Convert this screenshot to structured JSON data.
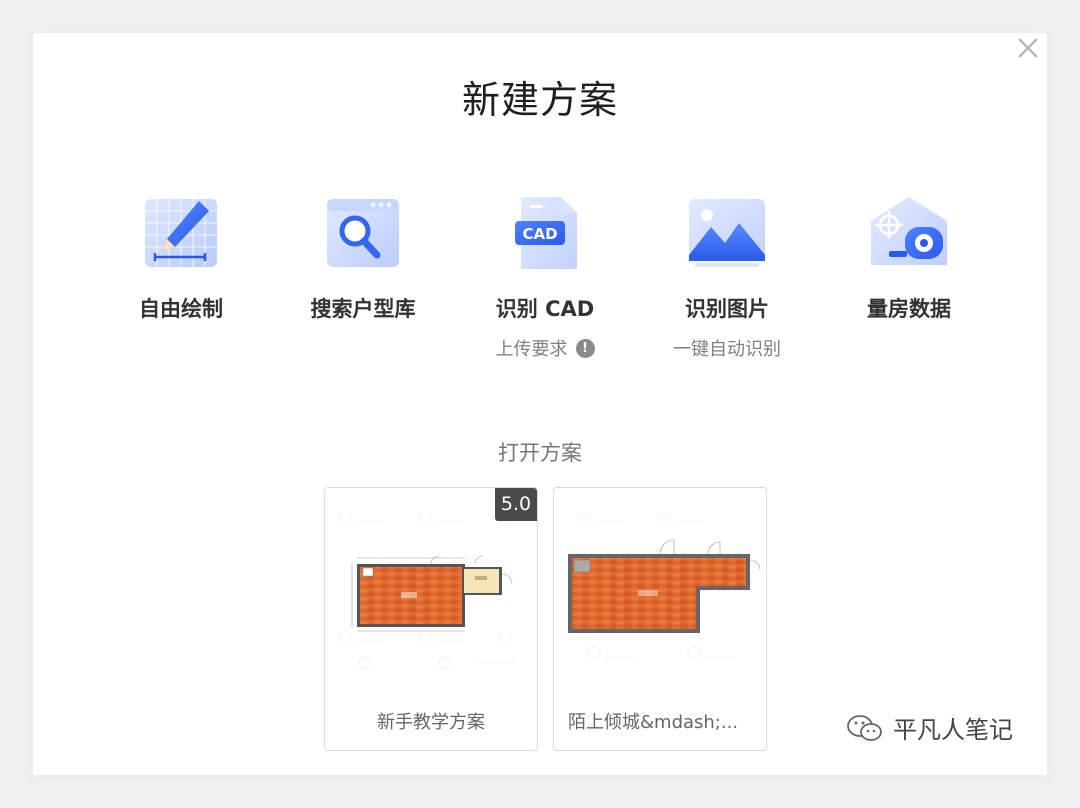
{
  "dialog": {
    "title": "新建方案",
    "close_icon": "close-icon"
  },
  "options": [
    {
      "label": "自由绘制",
      "icon": "pencil-ruler-icon"
    },
    {
      "label": "搜索户型库",
      "icon": "search-floorplan-icon"
    },
    {
      "label": "识别 CAD",
      "icon": "cad-file-icon",
      "sub": "上传要求"
    },
    {
      "label": "识别图片",
      "icon": "image-icon",
      "sub": "一键自动识别"
    },
    {
      "label": "量房数据",
      "icon": "measure-tape-icon"
    }
  ],
  "open_section": {
    "heading": "打开方案",
    "cards": [
      {
        "name": "新手教学方案",
        "badge": "5.0",
        "thumbnail": "floor-plan-thumbnail"
      },
      {
        "name": "陌上倾城&mdash;...",
        "thumbnail": "floor-plan-thumbnail"
      }
    ]
  },
  "watermark": {
    "text": "平凡人笔记",
    "icon": "wechat-icon"
  },
  "colors": {
    "accent": "#3b6ff5",
    "floor": "#e2692f",
    "badge_bg": "#4a4a4a"
  }
}
